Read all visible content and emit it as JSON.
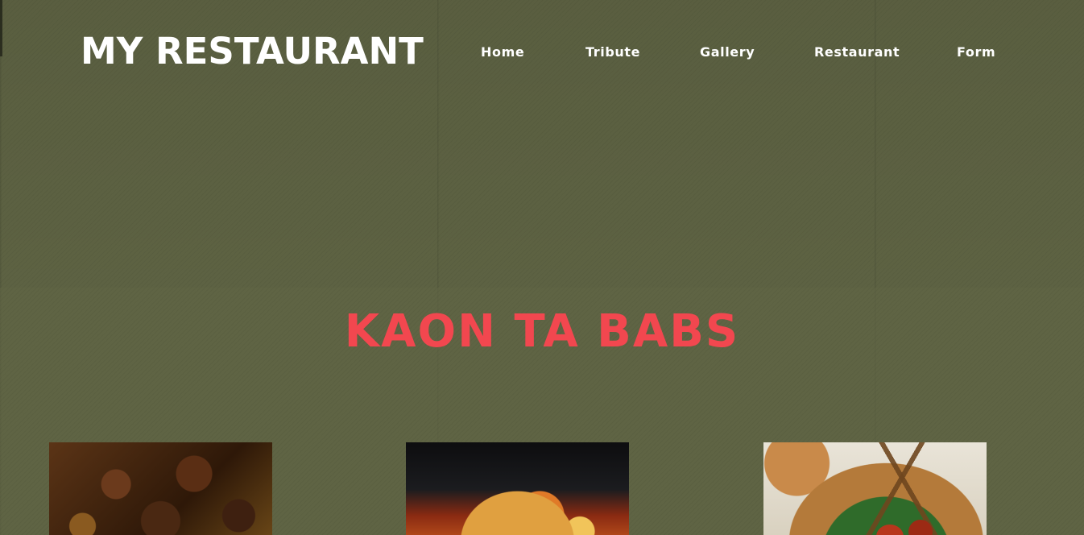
{
  "header": {
    "logo_text": "MY RESTAURANT",
    "nav": [
      {
        "label": "Home"
      },
      {
        "label": "Tribute"
      },
      {
        "label": "Gallery"
      },
      {
        "label": "Restaurant"
      },
      {
        "label": "Form"
      }
    ]
  },
  "main": {
    "title": "KAON TA BABS",
    "title_color": "#f2474f",
    "cards": [
      {
        "image": "braised-pork-adobo-photo"
      },
      {
        "image": "chicken-curry-pan-photo"
      },
      {
        "image": "grilled-skewers-bowl-photo"
      }
    ]
  },
  "colors": {
    "background": "#5f6444",
    "text": "#ffffff",
    "accent": "#f2474f"
  }
}
